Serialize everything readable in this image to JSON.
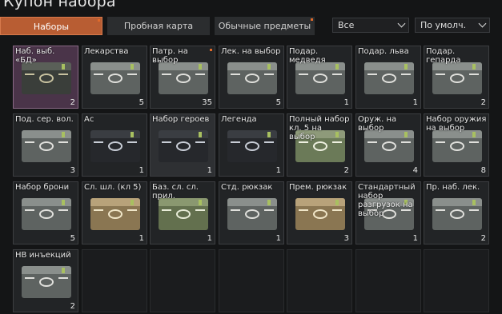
{
  "title": "Купон набора",
  "tabs": [
    {
      "label": "Наборы",
      "active": true,
      "dot": true
    },
    {
      "label": "Пробная карта",
      "active": false,
      "dot": false
    },
    {
      "label": "Обычные предметы",
      "active": false,
      "dot": true
    }
  ],
  "filter": {
    "value": "Все"
  },
  "sort": {
    "value": "По умолч."
  },
  "items": [
    {
      "label": "Наб. выб. «БД»",
      "count": "2",
      "box": "dark"
    },
    {
      "label": "Лекарства",
      "count": "5",
      "box": "grey"
    },
    {
      "label": "Патр. на выбор",
      "count": "35",
      "box": "grey",
      "dot": true
    },
    {
      "label": "Лек. на выбор",
      "count": "5",
      "box": "grey"
    },
    {
      "label": "Подар. медведя",
      "count": "1",
      "box": "grey"
    },
    {
      "label": "Подар. льва",
      "count": "1",
      "box": "grey"
    },
    {
      "label": "Подар. гепарда",
      "count": "2",
      "box": "grey"
    },
    {
      "label": "Под. сер. вол.",
      "count": "3",
      "box": "grey"
    },
    {
      "label": "Ас",
      "count": "1",
      "box": "black"
    },
    {
      "label": "Набор героев",
      "count": "1",
      "box": "black"
    },
    {
      "label": "Легенда",
      "count": "1",
      "box": "black"
    },
    {
      "label": "Полный набор кл. 5 на выбор",
      "count": "2",
      "box": "green"
    },
    {
      "label": "Оруж. на выбор",
      "count": "4",
      "box": "grey"
    },
    {
      "label": "Набор оружия на выбор",
      "count": "8",
      "box": "grey"
    },
    {
      "label": "Набор брони",
      "count": "5",
      "box": "grey"
    },
    {
      "label": "Сл. шл. (кл 5)",
      "count": "1",
      "box": "tan"
    },
    {
      "label": "Баз. сл. сл. прил.",
      "count": "1",
      "box": "olive"
    },
    {
      "label": "Стд. рюкзак",
      "count": "1",
      "box": "grey"
    },
    {
      "label": "Прем. рюкзак",
      "count": "3",
      "box": "tan"
    },
    {
      "label": "Стандартный набор разгрузок на выбор",
      "count": "1",
      "box": "grey"
    },
    {
      "label": "Пр. наб. лек.",
      "count": "2",
      "box": "grey"
    },
    {
      "label": "НВ инъекций",
      "count": "2",
      "box": "grey"
    }
  ],
  "box_colors": {
    "dark": [
      "#5a5f58",
      "#3a3e3a",
      "#c8c2a0"
    ],
    "grey": [
      "#8a8f8c",
      "#5e6361",
      "#e0e0dc"
    ],
    "black": [
      "#3a3d42",
      "#26282c",
      "#c8cdd6"
    ],
    "green": [
      "#8e9a7a",
      "#6b7a58",
      "#eef0e0"
    ],
    "tan": [
      "#b8a27a",
      "#8a7652",
      "#f0e6c8"
    ],
    "olive": [
      "#8a9870",
      "#63704e",
      "#e8ecd8"
    ]
  }
}
